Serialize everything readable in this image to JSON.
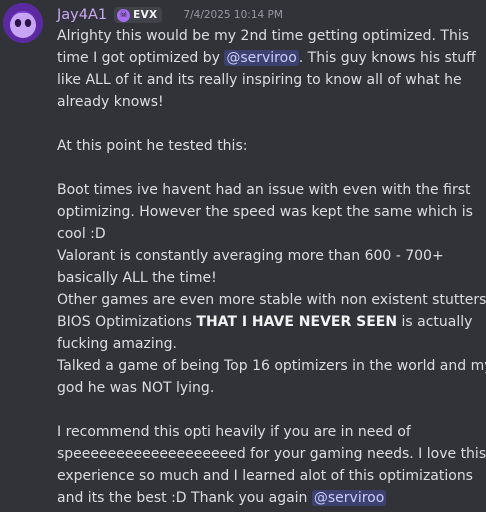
{
  "author": {
    "username": "Jay4A1",
    "tag_icon": "skull-icon",
    "tag_label": "EVX",
    "timestamp": "7/4/2025 10:14 PM",
    "avatar_icon": "purple-avatar"
  },
  "message": {
    "p1_l1": "Alrighty this would be my 2nd time getting optimized. This",
    "p1_l2_a": "time I got optimized by ",
    "mention1": "@serviroo",
    "p1_l2_b": ". This guy knows his stuff",
    "p1_l3": "like ALL of it and its really inspiring to know all of what he",
    "p1_l4": "already knows!",
    "p2": "At this point he tested this:",
    "p3_l1": "Boot times ive havent had an issue with even with the first",
    "p3_l2": "optimizing. However the speed was kept the same which is",
    "p3_l3": "cool :D",
    "p3_l4": "Valorant is constantly averaging more than 600 - 700+",
    "p3_l5": "basically ALL the time!",
    "p3_l6": "Other games are even more stable with non existent stutters",
    "p3_l7_a": "BIOS Optimizations ",
    "p3_l7_bold": "THAT I HAVE NEVER SEEN",
    "p3_l7_b": " is actually",
    "p3_l8": "fucking amazing.",
    "p3_l9": "Talked a game of being Top 16 optimizers in the world and my",
    "p3_l10": "god he was NOT lying.",
    "p4_l1": "I recommend this opti heavily if you are in need of",
    "p4_l2": "speeeeeeeeeeeeeeeeeeed for your gaming needs.  I love this",
    "p4_l3": "experience so much and I learned alot of this optimizations",
    "p4_l4_a": "and its the best :D Thank you again ",
    "mention2": "@serviroo"
  }
}
